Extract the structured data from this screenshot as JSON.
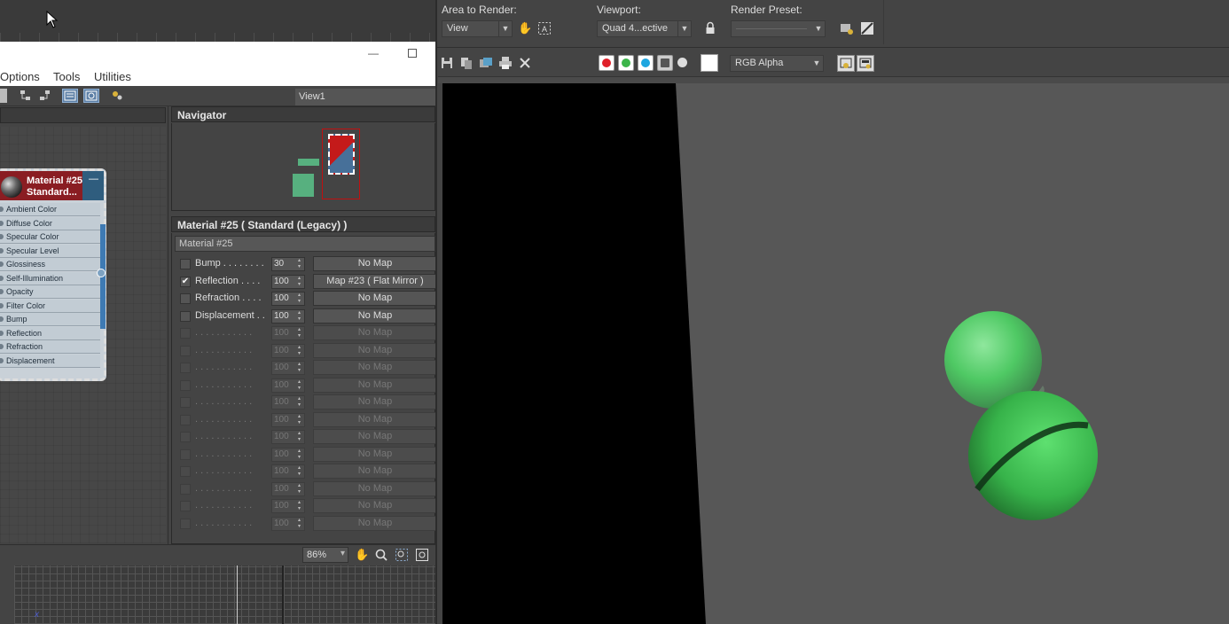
{
  "slate_editor": {
    "menu": [
      "Options",
      "Tools",
      "Utilities"
    ],
    "view_tab": "View1",
    "navigator_title": "Navigator",
    "node": {
      "title_line1": "Material #25",
      "title_line2": "Standard...",
      "collapse": "—",
      "slots": [
        "Ambient Color",
        "Diffuse Color",
        "Specular Color",
        "Specular Level",
        "Glossiness",
        "Self-Illumination",
        "Opacity",
        "Filter Color",
        "Bump",
        "Reflection",
        "Refraction",
        "Displacement"
      ]
    },
    "material_header": "Material #25  ( Standard (Legacy) )",
    "material_name": "Material #25",
    "maps": [
      {
        "checked": false,
        "label": "Bump . . . . . . . .",
        "amount": "30",
        "map": "No Map",
        "enabled": true
      },
      {
        "checked": true,
        "label": "Reflection  . . . .",
        "amount": "100",
        "map": "Map #23  ( Flat Mirror )",
        "enabled": true
      },
      {
        "checked": false,
        "label": "Refraction  . . . .",
        "amount": "100",
        "map": "No Map",
        "enabled": true
      },
      {
        "checked": false,
        "label": "Displacement  . .",
        "amount": "100",
        "map": "No Map",
        "enabled": true
      },
      {
        "checked": false,
        "label": ". . . . . . . . . . .",
        "amount": "100",
        "map": "No Map",
        "enabled": false
      },
      {
        "checked": false,
        "label": ". . . . . . . . . . .",
        "amount": "100",
        "map": "No Map",
        "enabled": false
      },
      {
        "checked": false,
        "label": ". . . . . . . . . . .",
        "amount": "100",
        "map": "No Map",
        "enabled": false
      },
      {
        "checked": false,
        "label": ". . . . . . . . . . .",
        "amount": "100",
        "map": "No Map",
        "enabled": false
      },
      {
        "checked": false,
        "label": ". . . . . . . . . . .",
        "amount": "100",
        "map": "No Map",
        "enabled": false
      },
      {
        "checked": false,
        "label": ". . . . . . . . . . .",
        "amount": "100",
        "map": "No Map",
        "enabled": false
      },
      {
        "checked": false,
        "label": ". . . . . . . . . . .",
        "amount": "100",
        "map": "No Map",
        "enabled": false
      },
      {
        "checked": false,
        "label": ". . . . . . . . . . .",
        "amount": "100",
        "map": "No Map",
        "enabled": false
      },
      {
        "checked": false,
        "label": ". . . . . . . . . . .",
        "amount": "100",
        "map": "No Map",
        "enabled": false
      },
      {
        "checked": false,
        "label": ". . . . . . . . . . .",
        "amount": "100",
        "map": "No Map",
        "enabled": false
      },
      {
        "checked": false,
        "label": ". . . . . . . . . . .",
        "amount": "100",
        "map": "No Map",
        "enabled": false
      },
      {
        "checked": false,
        "label": ". . . . . . . . . . .",
        "amount": "100",
        "map": "No Map",
        "enabled": false
      }
    ],
    "zoom": "86%",
    "axis_label": "x"
  },
  "render_window": {
    "area_to_render_label": "Area to Render:",
    "area_to_render_value": "View",
    "viewport_label": "Viewport:",
    "viewport_value": "Quad 4...ective",
    "render_preset_label": "Render Preset:",
    "render_preset_value": "",
    "channel_value": "RGB Alpha",
    "channel_colors": {
      "red": "#e0202a",
      "green": "#3cb54a",
      "blue": "#1ea6e0"
    }
  }
}
